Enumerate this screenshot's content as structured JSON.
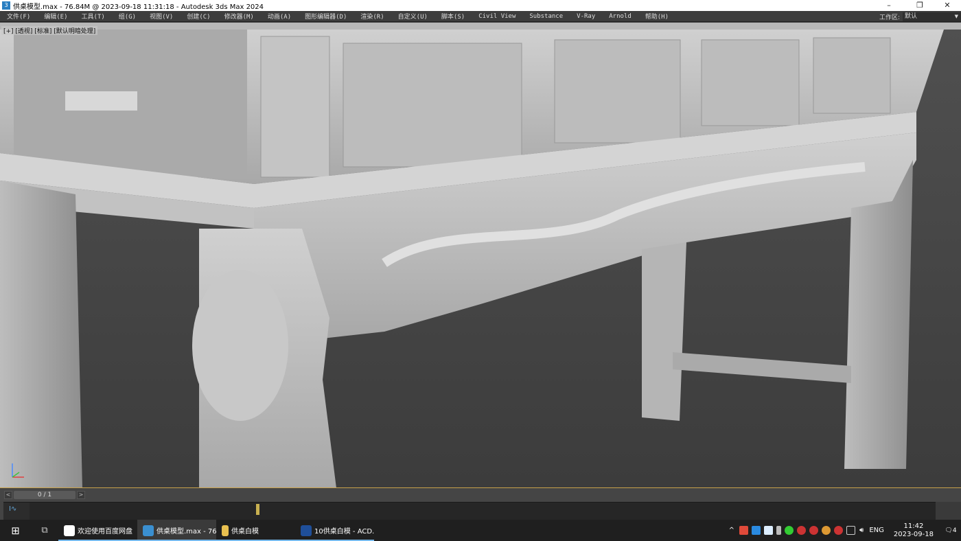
{
  "title": {
    "text": "供桌模型.max - 76.84M @ 2023-09-18 11:31:18 - Autodesk 3ds Max 2024",
    "app_icon": "3",
    "minimize": "–",
    "restore": "❐",
    "close": "✕"
  },
  "menu": [
    "文件(F)",
    "编辑(E)",
    "工具(T)",
    "组(G)",
    "视图(V)",
    "创建(C)",
    "修改器(M)",
    "动画(A)",
    "图形编辑器(D)",
    "渲染(R)",
    "自定义(U)",
    "脚本(S)",
    "Civil View",
    "Substance",
    "V-Ray",
    "Arnold",
    "帮助(H)"
  ],
  "workspace": {
    "label": "工作区:",
    "value": "默认"
  },
  "viewport": {
    "label": "[+] [透视] [标准] [默认明暗处理]"
  },
  "timeline": {
    "prev": "<",
    "frame": "0 / 1",
    "next": ">",
    "track_icon": "I∿"
  },
  "taskbar": {
    "items": [
      "欢迎使用百度网盘",
      "供桌模型.max - 76...",
      "供桌白模",
      "10供桌白模 - ACD..."
    ]
  },
  "tray": {
    "chevron": "^",
    "lang": "ENG",
    "time": "11:42",
    "date": "2023-09-18",
    "notifications": "4"
  },
  "colors": {
    "menubar": "#3d3d3d",
    "viewport": "#4a4a4a",
    "taskbar": "#1f1f1f",
    "accent": "#76b9ed"
  }
}
